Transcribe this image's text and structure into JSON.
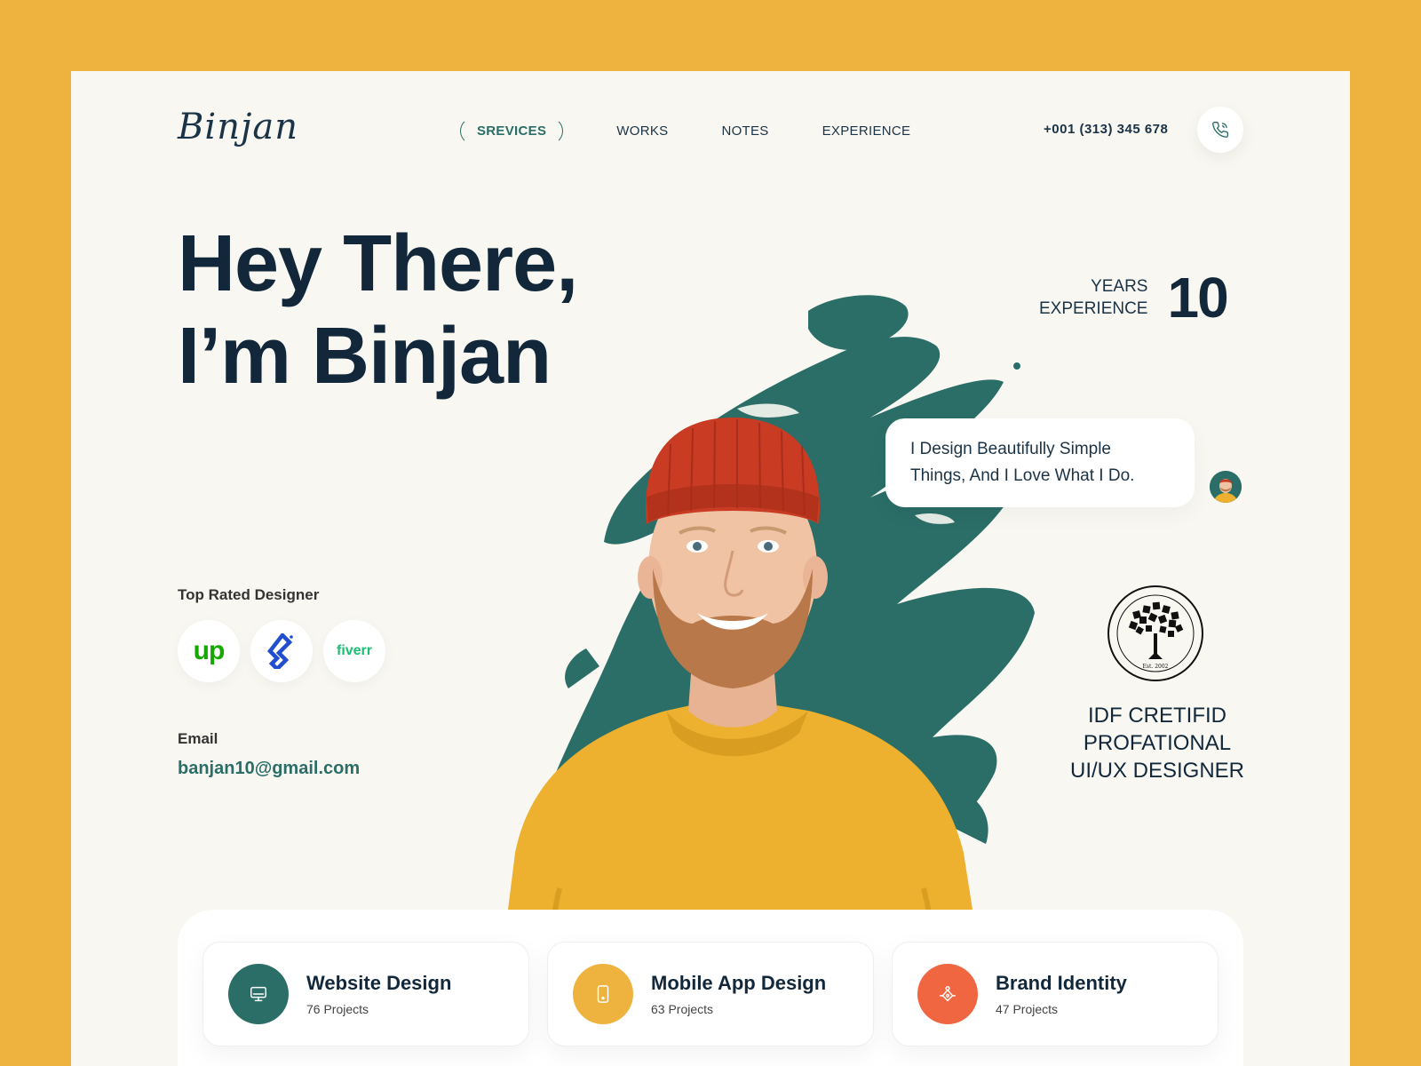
{
  "header": {
    "logo": "Binjan",
    "nav": [
      {
        "label": "SREVICES",
        "active": true
      },
      {
        "label": "WORKS",
        "active": false
      },
      {
        "label": "NOTES",
        "active": false
      },
      {
        "label": "EXPERIENCE",
        "active": false
      }
    ],
    "phone": "+001 (313) 345 678"
  },
  "hero": {
    "title_line1": "Hey There,",
    "title_line2": "I’m Binjan",
    "experience_label_1": "YEARS",
    "experience_label_2": "EXPERIENCE",
    "experience_value": "10",
    "quote_line1": "I Design Beautifully Simple",
    "quote_line2": "Things, And I Love What I Do.",
    "top_rated_label": "Top Rated Designer",
    "platforms": [
      "upwork-logo",
      "toptal-logo",
      "fiverr-logo"
    ],
    "platform_text": {
      "upwork": "up",
      "fiverr": "fiverr"
    },
    "email_label": "Email",
    "email_value": "banjan10@gmail.com",
    "seal_text": "Est. 2002",
    "cert_line1": "IDF CRETIFID",
    "cert_line2": "PROFATIONAL",
    "cert_line3": "UI/UX DESIGNER"
  },
  "services": [
    {
      "title": "Website Design",
      "projects": "76 Projects",
      "icon": "monitor-icon",
      "color": "#2A6E67"
    },
    {
      "title": "Mobile App Design",
      "projects": "63 Projects",
      "icon": "mobile-icon",
      "color": "#EEB33E"
    },
    {
      "title": "Brand Identity",
      "projects": "47 Projects",
      "icon": "brand-icon",
      "color": "#F06640"
    }
  ],
  "colors": {
    "background": "#EEB33E",
    "page": "#F8F7F2",
    "accent_green": "#2A6E67",
    "text_dark": "#12283A"
  }
}
